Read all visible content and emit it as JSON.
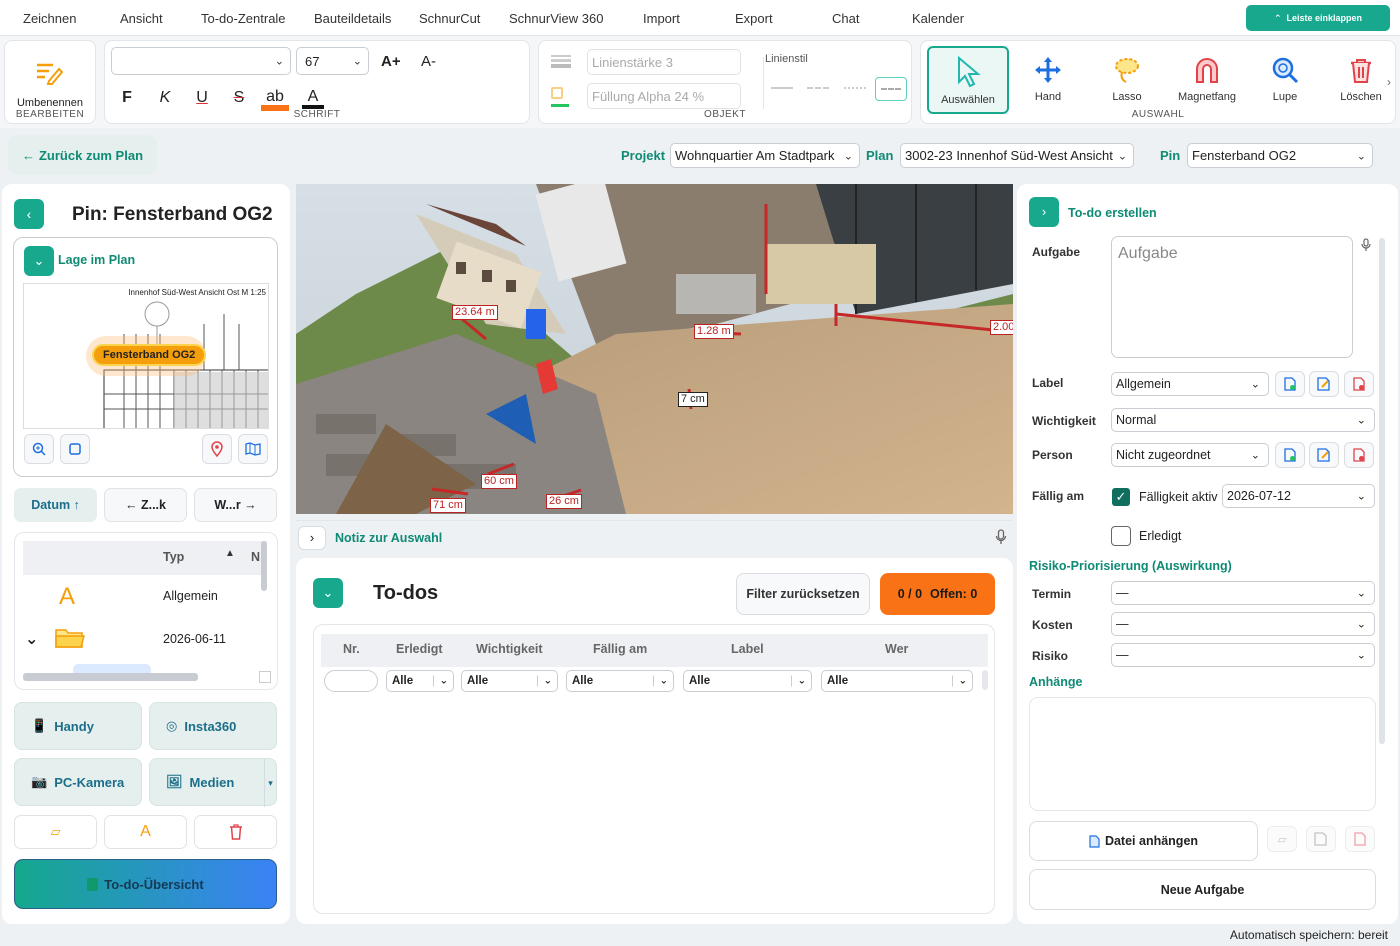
{
  "menu": [
    "Zeichnen",
    "Ansicht",
    "To-do-Zentrale",
    "Bauteildetails",
    "SchnurCut",
    "SchnurView 360",
    "Import",
    "Export",
    "Chat",
    "Kalender"
  ],
  "collapse_label": "Leiste einklappen",
  "ribbon": {
    "bearbeiten": {
      "rename_label": "Umbenennen",
      "title": "BEARBEITEN"
    },
    "schrift": {
      "font_value": "",
      "size_value": "67",
      "grow": "A+",
      "shrink": "A-",
      "bold": "F",
      "italic": "K",
      "underline": "U",
      "strike": "S",
      "highlight": "ab",
      "color": "A",
      "title": "SCHRIFT"
    },
    "objekt": {
      "line_width_placeholder": "Linienstärke 3",
      "fill_alpha_placeholder": "Füllung Alpha 24 %",
      "line_style_label": "Linienstil",
      "title": "OBJEKT"
    },
    "auswahl": {
      "tools": [
        "Auswählen",
        "Hand",
        "Lasso",
        "Magnetfang",
        "Lupe",
        "Löschen"
      ],
      "title": "AUSWAHL"
    }
  },
  "back_button": "Zurück zum Plan",
  "context": {
    "projekt_label": "Projekt",
    "projekt_value": "Wohnquartier Am Stadtpark",
    "plan_label": "Plan",
    "plan_value": "3002-23 Innenhof Süd-West Ansicht",
    "pin_label": "Pin",
    "pin_value": "Fensterband OG2"
  },
  "left": {
    "title": "Pin: Fensterband OG2",
    "lage_label": "Lage im Plan",
    "plan_caption": "Innenhof Süd-West Ansicht Ost  M 1:25",
    "pin_tag": "Fensterband OG2",
    "sort_buttons": [
      "Datum ↑",
      "← Z...k",
      "W...r  →"
    ],
    "list_header": "Typ",
    "list_header_extra": "N",
    "list_rows": [
      "Allgemein",
      "2026-06-11"
    ],
    "capture_buttons": [
      "Handy",
      "Insta360",
      "PC-Kamera",
      "Medien"
    ],
    "overview_button": "To-do-Übersicht"
  },
  "viewer": {
    "measurements": [
      "23.64 m",
      "1.28 m",
      "2.00",
      "7 cm",
      "60 cm",
      "71 cm",
      "26 cm"
    ],
    "note_label": "Notiz zur Auswahl"
  },
  "todos": {
    "title": "To-dos",
    "reset_button": "Filter zurücksetzen",
    "status_count": "0 / 0",
    "status_open": "Offen: 0",
    "columns": [
      "Nr.",
      "Erledigt",
      "Wichtigkeit",
      "Fällig am",
      "Label",
      "Wer"
    ],
    "filters": [
      "Alle",
      "Alle",
      "Alle",
      "Alle",
      "Alle"
    ]
  },
  "right": {
    "title": "To-do erstellen",
    "aufgabe_label": "Aufgabe",
    "aufgabe_placeholder": "Aufgabe",
    "label_label": "Label",
    "label_value": "Allgemein",
    "wichtigkeit_label": "Wichtigkeit",
    "wichtigkeit_value": "Normal",
    "person_label": "Person",
    "person_value": "Nicht zugeordnet",
    "faellig_label": "Fällig am",
    "faellig_toggle": "Fälligkeit aktiv",
    "faellig_value": "2026-07-12",
    "erledigt_label": "Erledigt",
    "risiko_title": "Risiko-Priorisierung (Auswirkung)",
    "termin_label": "Termin",
    "termin_value": "—",
    "kosten_label": "Kosten",
    "kosten_value": "—",
    "risiko_label": "Risiko",
    "risiko_value": "—",
    "anhaenge_title": "Anhänge",
    "attach_button": "Datei anhängen",
    "new_task_button": "Neue Aufgabe"
  },
  "status_bar": "Automatisch speichern: bereit",
  "colors": {
    "accent": "#17a88e",
    "orange": "#f97316",
    "red": "#e0444a"
  }
}
